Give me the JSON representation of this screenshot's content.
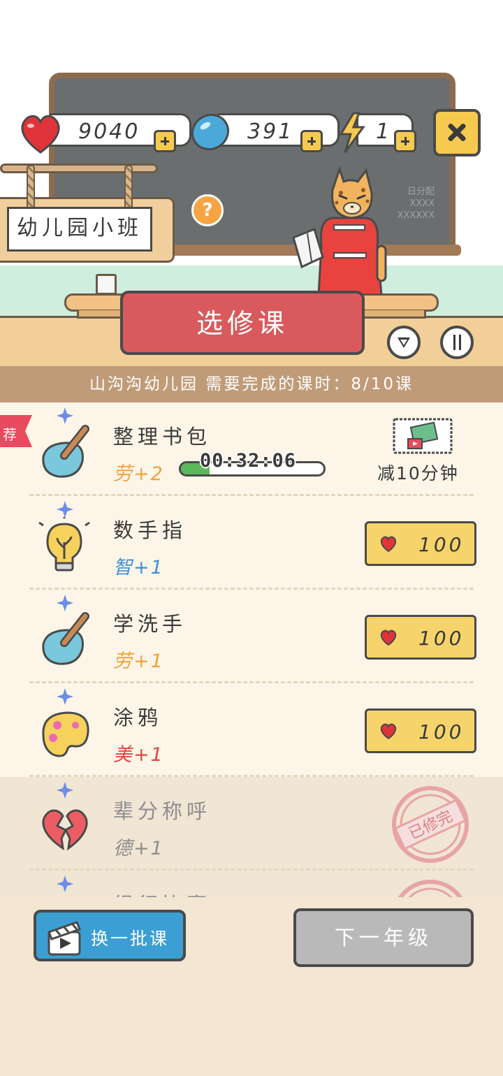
{
  "resources": {
    "hearts": "9040",
    "gems": "391",
    "energy": "1"
  },
  "grade_sign": "幼儿园小班",
  "help": "?",
  "elective_banner": "选修课",
  "board_text": [
    "日分配",
    "XXXX",
    "XXXXXX"
  ],
  "progress_strip": "山沟沟幼儿园 需要完成的课时：8/10课",
  "courses": [
    {
      "title": "整理书包",
      "gain": "劳+2",
      "recommended_tag": "荐",
      "timer": "00:32:06",
      "timer_progress": 0.2,
      "speedup_label": "减10分钟"
    },
    {
      "title": "数手指",
      "gain": "智+1",
      "price": "100"
    },
    {
      "title": "学洗手",
      "gain": "劳+1",
      "price": "100"
    },
    {
      "title": "涂鸦",
      "gain": "美+1",
      "price": "100"
    },
    {
      "title": "辈分称呼",
      "gain": "德+1",
      "status_stamp": "已修完"
    },
    {
      "title": "绳行比赛"
    }
  ],
  "bottom": {
    "swap_label": "换一批课",
    "next_grade_label": "下一年级"
  },
  "colors": {
    "accent_red": "#d95a5c",
    "button_yellow": "#f6d36b",
    "swap_blue": "#3b9fd3",
    "disabled_gray": "#b9b9b9",
    "labor": "#f1a23d",
    "wisdom": "#3f8fd6",
    "art": "#e2443f"
  },
  "icons": {
    "heart": "heart-icon",
    "gem": "gem-icon",
    "energy": "lightning-icon",
    "close": "close-icon",
    "filter": "filter-icon",
    "sort": "sort-icon",
    "video_ticket": "video-ticket-icon",
    "clapperboard": "clapperboard-icon"
  }
}
